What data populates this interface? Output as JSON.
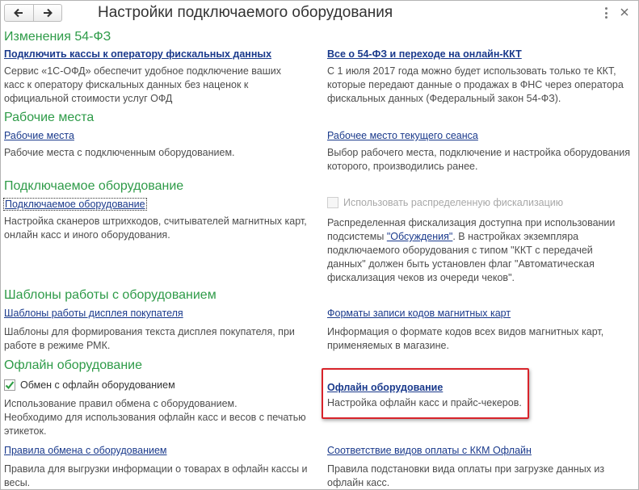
{
  "window": {
    "title": "Настройки подключаемого оборудования",
    "icons": {
      "back": "arrow-left-icon",
      "forward": "arrow-right-icon",
      "menu": "more-vertical-icon",
      "close": "close-icon"
    }
  },
  "sections": {
    "fz54": {
      "title": "Изменения 54-ФЗ",
      "left_link": "Подключить кассы к оператору фискальных данных",
      "left_desc": [
        "Сервис  «1С-ОФД» обеспечит удобное подключение ваших",
        "касс к оператору фискальных данных без наценок к",
        "официальной стоимости услуг ОФД"
      ],
      "right_link": "Все о 54-ФЗ и переходе на онлайн-ККТ",
      "right_desc": [
        "С 1 июля 2017 года можно будет использовать только те ККТ,",
        "которые передают данные о продажах в ФНС через оператора",
        "фискальных данных (Федеральный закон 54-ФЗ)."
      ]
    },
    "workplaces": {
      "title": "Рабочие места",
      "left_link": "Рабочие места",
      "left_desc": [
        "Рабочие места с подключенным оборудованием."
      ],
      "right_link": "Рабочее место текущего сеанса",
      "right_desc": [
        "Выбор рабочего места, подключение и настройка оборудования",
        "которого, производились ранее."
      ]
    },
    "equipment": {
      "title": "Подключаемое оборудование",
      "left_link": "Подключаемое оборудование",
      "left_desc": [
        "Настройка сканеров штрихкодов, считывателей магнитных карт,",
        "онлайн касс и иного оборудования."
      ],
      "checkbox_label": "Использовать распределенную фискализацию",
      "checkbox_checked": false,
      "right_desc": {
        "line1": "Распределенная фискализация доступна при использовании",
        "line2_before": "подсистемы ",
        "line2_link": "\"Обсуждения\"",
        "line2_after": ". В настройках экземпляра",
        "line3": "подключаемого оборудования с типом \"ККТ с передачей",
        "line4": "данных\" должен быть установлен флаг \"Автоматическая",
        "line5": "фискализация чеков из очереди чеков\"."
      }
    },
    "templates": {
      "title": "Шаблоны работы с оборудованием",
      "left_link": "Шаблоны работы дисплея покупателя",
      "left_desc": [
        "Шаблоны для формирования текста дисплея покупателя, при",
        "работе в режиме РМК."
      ],
      "right_link": "Форматы записи кодов магнитных карт",
      "right_desc": [
        "Информация о формате кодов всех видов магнитных карт,",
        "применяемых в магазине."
      ]
    },
    "offline": {
      "title": "Офлайн оборудование",
      "checkbox_label": "Обмен с офлайн оборудованием",
      "checkbox_checked": true,
      "left_desc": [
        "Использование правил обмена с оборудованием.",
        "Необходимо для использования офлайн касс и весов с печатью",
        "этикеток."
      ],
      "right_link": "Офлайн оборудование",
      "right_desc": [
        "Настройка офлайн касс и прайс-чекеров."
      ],
      "rules_link": "Правила обмена с оборудованием",
      "rules_desc": [
        "Правила для выгрузки информации о товарах в офлайн кассы и",
        "весы."
      ],
      "payment_link": "Соответствие видов оплаты с ККМ Офлайн",
      "payment_desc": [
        "Правила подстановки вида оплаты при загрузке данных из",
        "офлайн касс."
      ]
    }
  },
  "colors": {
    "section_title": "#2e9b48",
    "link": "#1a3a8c",
    "text": "#4d4d4d",
    "highlight": "#d8232a",
    "check": "#2f9e44"
  }
}
